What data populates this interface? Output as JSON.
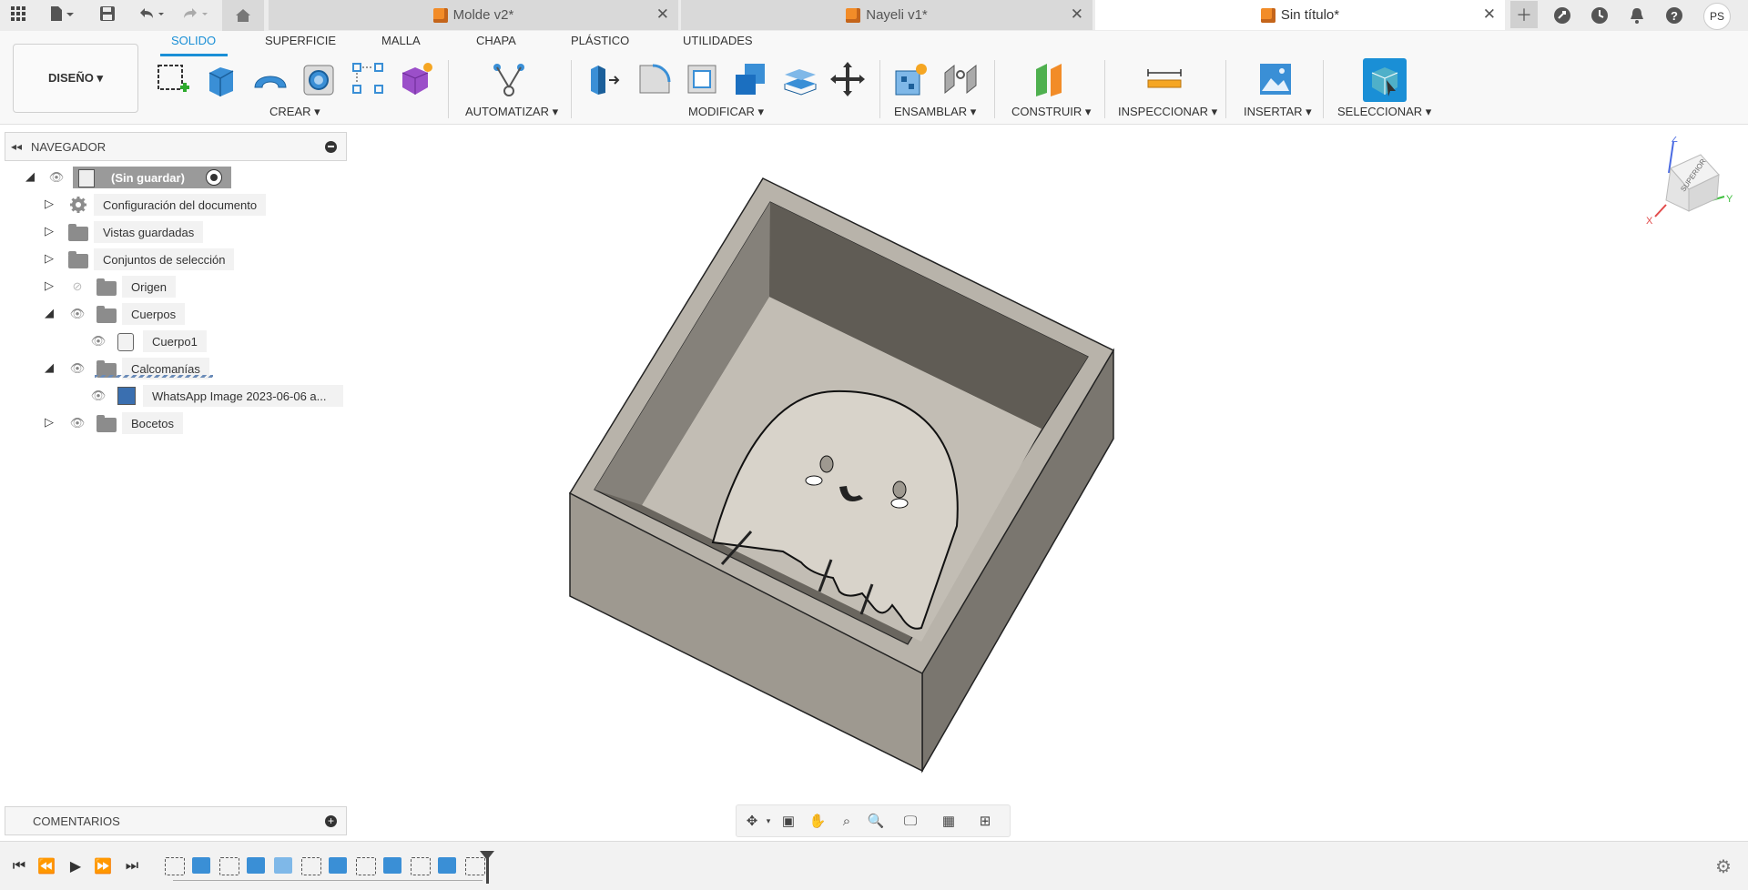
{
  "titlebar": {
    "tabs": [
      {
        "label": "Molde v2*"
      },
      {
        "label": "Nayeli v1*"
      },
      {
        "label": "Sin título*"
      }
    ],
    "user_initials": "PS"
  },
  "workspace": {
    "label": "DISEÑO ▾"
  },
  "toolbar": {
    "tabs": [
      "SOLIDO",
      "SUPERFICIE",
      "MALLA",
      "CHAPA",
      "PLÁSTICO",
      "UTILIDADES"
    ],
    "groups": {
      "crear": "CREAR ▾",
      "automatizar": "AUTOMATIZAR ▾",
      "modificar": "MODIFICAR ▾",
      "ensamblar": "ENSAMBLAR ▾",
      "construir": "CONSTRUIR ▾",
      "inspeccionar": "INSPECCIONAR ▾",
      "insertar": "INSERTAR ▾",
      "seleccionar": "SELECCIONAR ▾"
    }
  },
  "browser": {
    "title": "NAVEGADOR",
    "root": "(Sin guardar)",
    "items": [
      {
        "label": "Configuración del documento"
      },
      {
        "label": "Vistas guardadas"
      },
      {
        "label": "Conjuntos de selección"
      },
      {
        "label": "Origen"
      },
      {
        "label": "Cuerpos"
      },
      {
        "label": "Cuerpo1"
      },
      {
        "label": "Calcomanías"
      },
      {
        "label": "WhatsApp Image 2023-06-06 a..."
      },
      {
        "label": "Bocetos"
      }
    ]
  },
  "comments": {
    "title": "COMENTARIOS"
  },
  "viewcube": {
    "face_label": "SUPERIOR",
    "axis_x": "X",
    "axis_y": "Y",
    "axis_z": "Z"
  },
  "colors": {
    "accent": "#1a8fd6",
    "brand_orange": "#f28c28"
  }
}
